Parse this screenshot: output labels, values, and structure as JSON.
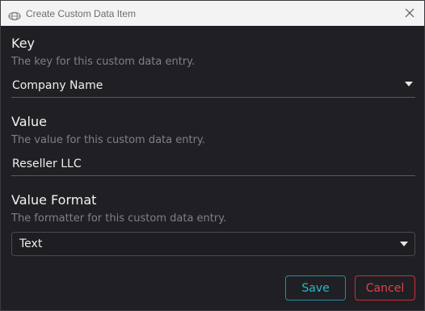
{
  "window": {
    "title": "Create Custom Data Item",
    "app_icon": "app-logo-icon",
    "close_icon": "close-icon"
  },
  "fields": {
    "key": {
      "label": "Key",
      "description": "The key for this custom data entry.",
      "value": "Company Name",
      "icon": "chevron-down-icon"
    },
    "value": {
      "label": "Value",
      "description": "The value for this custom data entry.",
      "value": "Reseller LLC"
    },
    "format": {
      "label": "Value Format",
      "description": "The formatter for this custom data entry.",
      "value": "Text",
      "icon": "chevron-down-icon"
    }
  },
  "buttons": {
    "save_label": "Save",
    "cancel_label": "Cancel"
  },
  "colors": {
    "background": "#202024",
    "save_accent": "#2bb6cc",
    "cancel_accent": "#e0404c"
  }
}
